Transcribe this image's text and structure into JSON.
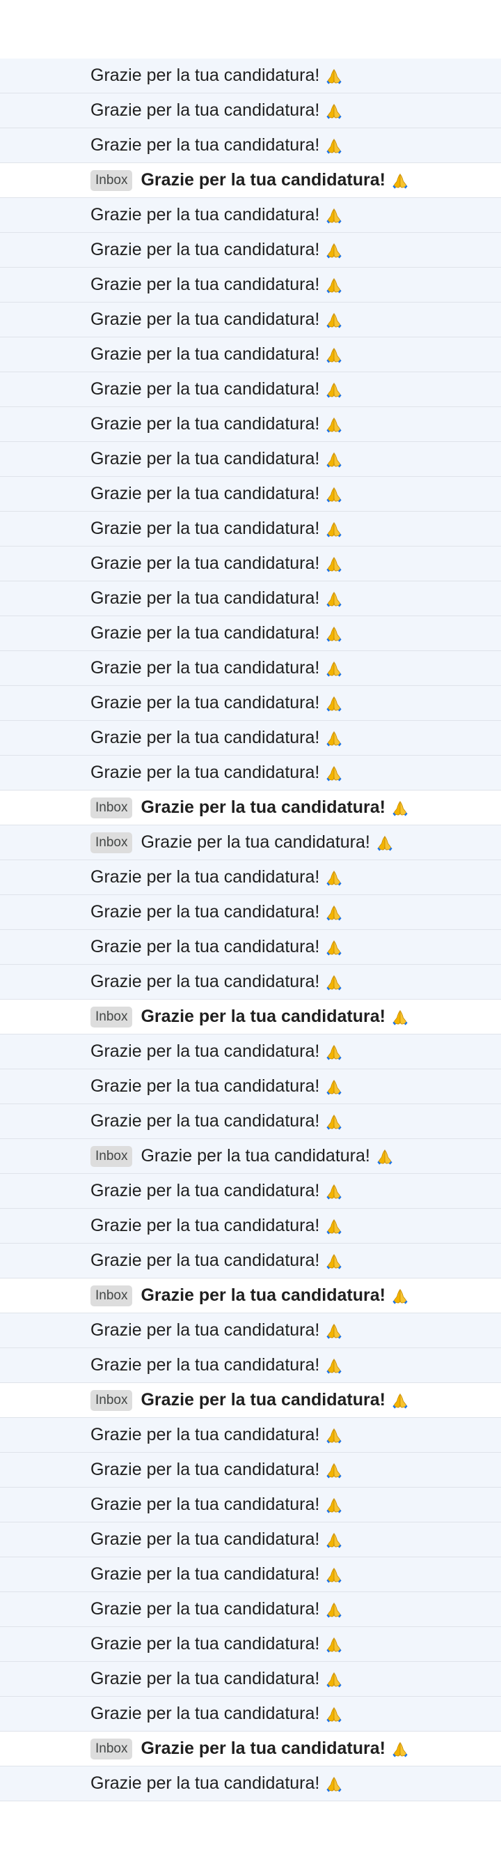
{
  "email_list": {
    "badge_label": "Inbox",
    "subject_text": "Grazie per la tua candidatura!",
    "emoji_icon": "folded-hands-icon",
    "colors": {
      "read_row_background": "#f2f6fc",
      "unread_row_background": "#ffffff",
      "badge_background": "#dddddd",
      "text": "#1f1f1f"
    },
    "rows": [
      {
        "subject": "Grazie per la tua candidatura!",
        "label": "",
        "unread": false
      },
      {
        "subject": "Grazie per la tua candidatura!",
        "label": "",
        "unread": false
      },
      {
        "subject": "Grazie per la tua candidatura!",
        "label": "",
        "unread": false
      },
      {
        "subject": "Grazie per la tua candidatura!",
        "label": "Inbox",
        "unread": true
      },
      {
        "subject": "Grazie per la tua candidatura!",
        "label": "",
        "unread": false
      },
      {
        "subject": "Grazie per la tua candidatura!",
        "label": "",
        "unread": false
      },
      {
        "subject": "Grazie per la tua candidatura!",
        "label": "",
        "unread": false
      },
      {
        "subject": "Grazie per la tua candidatura!",
        "label": "",
        "unread": false
      },
      {
        "subject": "Grazie per la tua candidatura!",
        "label": "",
        "unread": false
      },
      {
        "subject": "Grazie per la tua candidatura!",
        "label": "",
        "unread": false
      },
      {
        "subject": "Grazie per la tua candidatura!",
        "label": "",
        "unread": false
      },
      {
        "subject": "Grazie per la tua candidatura!",
        "label": "",
        "unread": false
      },
      {
        "subject": "Grazie per la tua candidatura!",
        "label": "",
        "unread": false
      },
      {
        "subject": "Grazie per la tua candidatura!",
        "label": "",
        "unread": false
      },
      {
        "subject": "Grazie per la tua candidatura!",
        "label": "",
        "unread": false
      },
      {
        "subject": "Grazie per la tua candidatura!",
        "label": "",
        "unread": false
      },
      {
        "subject": "Grazie per la tua candidatura!",
        "label": "",
        "unread": false
      },
      {
        "subject": "Grazie per la tua candidatura!",
        "label": "",
        "unread": false
      },
      {
        "subject": "Grazie per la tua candidatura!",
        "label": "",
        "unread": false
      },
      {
        "subject": "Grazie per la tua candidatura!",
        "label": "",
        "unread": false
      },
      {
        "subject": "Grazie per la tua candidatura!",
        "label": "",
        "unread": false
      },
      {
        "subject": "Grazie per la tua candidatura!",
        "label": "Inbox",
        "unread": true
      },
      {
        "subject": "Grazie per la tua candidatura!",
        "label": "Inbox",
        "unread": false
      },
      {
        "subject": "Grazie per la tua candidatura!",
        "label": "",
        "unread": false
      },
      {
        "subject": "Grazie per la tua candidatura!",
        "label": "",
        "unread": false
      },
      {
        "subject": "Grazie per la tua candidatura!",
        "label": "",
        "unread": false
      },
      {
        "subject": "Grazie per la tua candidatura!",
        "label": "",
        "unread": false
      },
      {
        "subject": "Grazie per la tua candidatura!",
        "label": "Inbox",
        "unread": true
      },
      {
        "subject": "Grazie per la tua candidatura!",
        "label": "",
        "unread": false
      },
      {
        "subject": "Grazie per la tua candidatura!",
        "label": "",
        "unread": false
      },
      {
        "subject": "Grazie per la tua candidatura!",
        "label": "",
        "unread": false
      },
      {
        "subject": "Grazie per la tua candidatura!",
        "label": "Inbox",
        "unread": false
      },
      {
        "subject": "Grazie per la tua candidatura!",
        "label": "",
        "unread": false
      },
      {
        "subject": "Grazie per la tua candidatura!",
        "label": "",
        "unread": false
      },
      {
        "subject": "Grazie per la tua candidatura!",
        "label": "",
        "unread": false
      },
      {
        "subject": "Grazie per la tua candidatura!",
        "label": "Inbox",
        "unread": true
      },
      {
        "subject": "Grazie per la tua candidatura!",
        "label": "",
        "unread": false
      },
      {
        "subject": "Grazie per la tua candidatura!",
        "label": "",
        "unread": false
      },
      {
        "subject": "Grazie per la tua candidatura!",
        "label": "Inbox",
        "unread": true
      },
      {
        "subject": "Grazie per la tua candidatura!",
        "label": "",
        "unread": false
      },
      {
        "subject": "Grazie per la tua candidatura!",
        "label": "",
        "unread": false
      },
      {
        "subject": "Grazie per la tua candidatura!",
        "label": "",
        "unread": false
      },
      {
        "subject": "Grazie per la tua candidatura!",
        "label": "",
        "unread": false
      },
      {
        "subject": "Grazie per la tua candidatura!",
        "label": "",
        "unread": false
      },
      {
        "subject": "Grazie per la tua candidatura!",
        "label": "",
        "unread": false
      },
      {
        "subject": "Grazie per la tua candidatura!",
        "label": "",
        "unread": false
      },
      {
        "subject": "Grazie per la tua candidatura!",
        "label": "",
        "unread": false
      },
      {
        "subject": "Grazie per la tua candidatura!",
        "label": "",
        "unread": false
      },
      {
        "subject": "Grazie per la tua candidatura!",
        "label": "Inbox",
        "unread": true
      },
      {
        "subject": "Grazie per la tua candidatura!",
        "label": "",
        "unread": false
      }
    ]
  }
}
